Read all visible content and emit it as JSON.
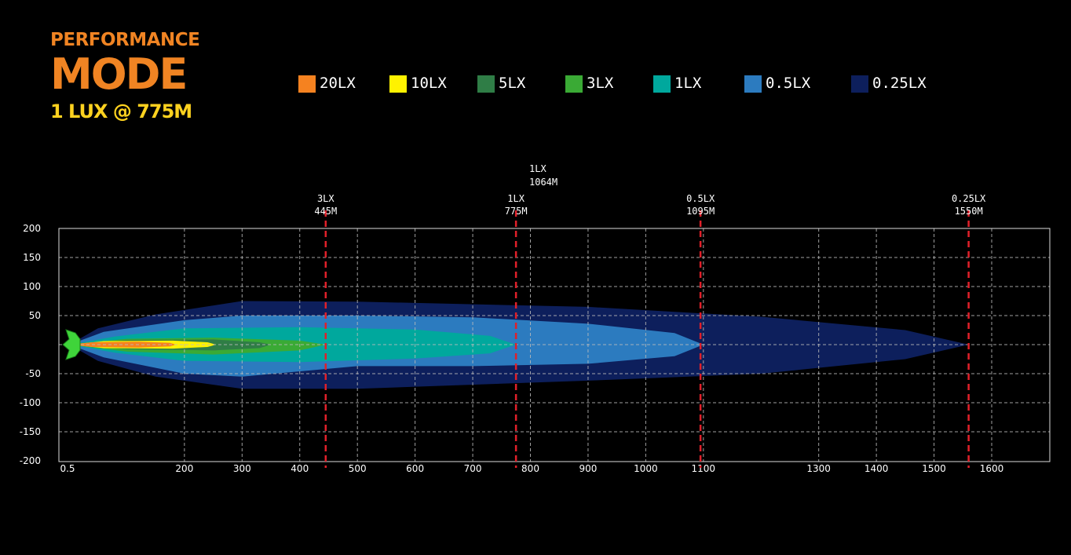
{
  "heading": {
    "line1": "PERFORMANCE",
    "line2": "MODE",
    "line3": "1 LUX @ 775M"
  },
  "legend": [
    {
      "label": "20LX",
      "color": "#f58220"
    },
    {
      "label": "10LX",
      "color": "#fff200"
    },
    {
      "label": "5LX",
      "color": "#2f7d46"
    },
    {
      "label": "3LX",
      "color": "#3aaa35"
    },
    {
      "label": "1LX",
      "color": "#00a89d"
    },
    {
      "label": "0.5LX",
      "color": "#2c7bbf"
    },
    {
      "label": "0.25LX",
      "color": "#0d1f5c"
    }
  ],
  "chart_data": {
    "type": "area",
    "title": "",
    "xlabel": "",
    "ylabel": "",
    "x_ticks": [
      "0.5",
      "200",
      "300",
      "400",
      "500",
      "600",
      "700",
      "800",
      "900",
      "1000",
      "1100",
      "1300",
      "1400",
      "1500",
      "1600"
    ],
    "y_ticks": [
      "200",
      "150",
      "100",
      "50",
      "-50",
      "-100",
      "-150",
      "-200"
    ],
    "ylim": [
      -200,
      200
    ],
    "grid": true,
    "series": [
      {
        "name": "0.25LX",
        "color": "#0d1f5c",
        "points": [
          [
            0.5,
            0
          ],
          [
            50,
            28
          ],
          [
            150,
            52
          ],
          [
            300,
            75
          ],
          [
            500,
            74
          ],
          [
            900,
            65
          ],
          [
            1200,
            48
          ],
          [
            1450,
            25
          ],
          [
            1560,
            0
          ],
          [
            1450,
            -25
          ],
          [
            1200,
            -50
          ],
          [
            900,
            -62
          ],
          [
            500,
            -76
          ],
          [
            300,
            -76
          ],
          [
            150,
            -55
          ],
          [
            50,
            -28
          ]
        ]
      },
      {
        "name": "0.5LX",
        "color": "#2c7bbf",
        "points": [
          [
            0.5,
            0
          ],
          [
            60,
            22
          ],
          [
            200,
            42
          ],
          [
            300,
            50
          ],
          [
            500,
            50
          ],
          [
            700,
            47
          ],
          [
            900,
            36
          ],
          [
            1050,
            20
          ],
          [
            1100,
            0
          ],
          [
            1050,
            -20
          ],
          [
            900,
            -33
          ],
          [
            700,
            -37
          ],
          [
            500,
            -37
          ],
          [
            300,
            -55
          ],
          [
            200,
            -50
          ],
          [
            60,
            -22
          ]
        ]
      },
      {
        "name": "1LX",
        "color": "#00a89d",
        "points": [
          [
            0.5,
            0
          ],
          [
            80,
            14
          ],
          [
            200,
            28
          ],
          [
            400,
            30
          ],
          [
            600,
            26
          ],
          [
            730,
            15
          ],
          [
            775,
            0
          ],
          [
            730,
            -15
          ],
          [
            600,
            -24
          ],
          [
            400,
            -30
          ],
          [
            200,
            -28
          ],
          [
            80,
            -14
          ]
        ]
      },
      {
        "name": "3LX",
        "color": "#3aaa35",
        "points": [
          [
            0.5,
            0
          ],
          [
            100,
            10
          ],
          [
            250,
            12
          ],
          [
            400,
            7
          ],
          [
            445,
            0
          ],
          [
            400,
            -10
          ],
          [
            250,
            -17
          ],
          [
            100,
            -12
          ]
        ]
      },
      {
        "name": "5LX",
        "color": "#2f7d46",
        "points": [
          [
            0.5,
            0
          ],
          [
            100,
            8
          ],
          [
            250,
            9
          ],
          [
            330,
            4
          ],
          [
            350,
            0
          ],
          [
            330,
            -6
          ],
          [
            250,
            -10
          ],
          [
            100,
            -8
          ]
        ]
      },
      {
        "name": "10LX",
        "color": "#fff200",
        "points": [
          [
            0.5,
            0
          ],
          [
            60,
            6
          ],
          [
            180,
            7
          ],
          [
            240,
            4
          ],
          [
            255,
            0
          ],
          [
            240,
            -4
          ],
          [
            180,
            -7
          ],
          [
            60,
            -6
          ]
        ]
      },
      {
        "name": "20LX",
        "color": "#f58220",
        "points": [
          [
            0.5,
            0
          ],
          [
            40,
            4
          ],
          [
            120,
            5
          ],
          [
            175,
            3
          ],
          [
            185,
            0
          ],
          [
            175,
            -3
          ],
          [
            120,
            -5
          ],
          [
            40,
            -4
          ]
        ]
      }
    ],
    "markers": [
      {
        "x": 445,
        "line1": "3LX",
        "line2": "445M"
      },
      {
        "x": 775,
        "line1": "1LX",
        "line2": "775M"
      },
      {
        "x": 1095,
        "line1": "0.5LX",
        "line2": "1095M"
      },
      {
        "x": 1560,
        "line1": "0.25LX",
        "line2": "1550M"
      }
    ],
    "annotation": {
      "x": 840,
      "line1": "1LX",
      "line2": "1064M"
    }
  }
}
